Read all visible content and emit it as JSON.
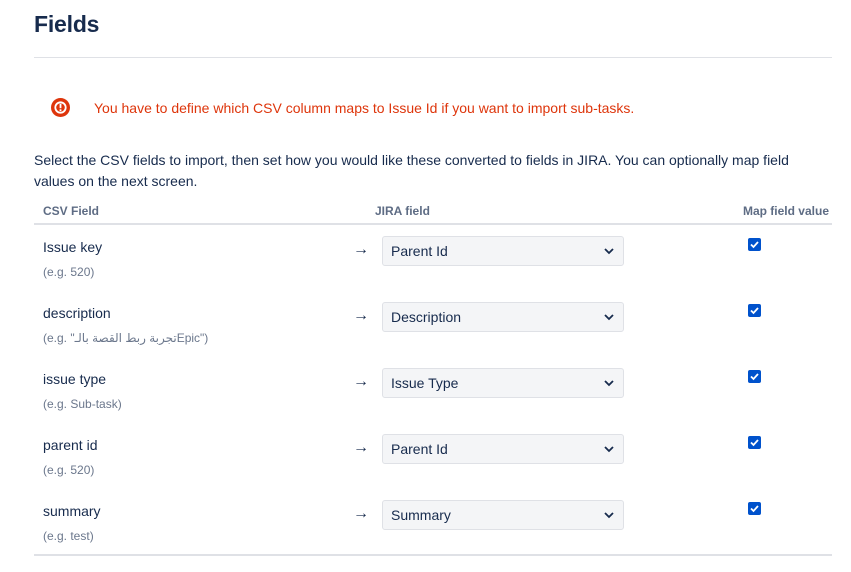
{
  "page": {
    "title": "Fields",
    "error_message": "You have to define which CSV column maps to Issue Id if you want to import sub-tasks.",
    "intro": "Select the CSV fields to import, then set how you would like these converted to fields in JIRA. You can optionally map field values on the next screen."
  },
  "table": {
    "headers": {
      "csv_field": "CSV Field",
      "jira_field": "JIRA field",
      "map_field_value": "Map field value"
    },
    "arrow": "→",
    "rows": [
      {
        "csv_field": "Issue key",
        "example": "(e.g. 520)",
        "jira_field": "Parent Id",
        "map_value": true
      },
      {
        "csv_field": "description",
        "example": "(e.g. \"تجربة ربط القصة بالـEpic\")",
        "jira_field": "Description",
        "map_value": true
      },
      {
        "csv_field": "issue type",
        "example": "(e.g. Sub-task)",
        "jira_field": "Issue Type",
        "map_value": true
      },
      {
        "csv_field": "parent id",
        "example": "(e.g. 520)",
        "jira_field": "Parent Id",
        "map_value": true
      },
      {
        "csv_field": "summary",
        "example": "(e.g. test)",
        "jira_field": "Summary",
        "map_value": true
      }
    ]
  },
  "colors": {
    "error": "#de350b",
    "checkbox": "#0052cc",
    "text": "#172b4d",
    "muted": "#6b778c"
  },
  "icons": {
    "error": "error-icon",
    "select_chevron": "chevron-down-icon",
    "checkbox_mark": "check-icon"
  }
}
